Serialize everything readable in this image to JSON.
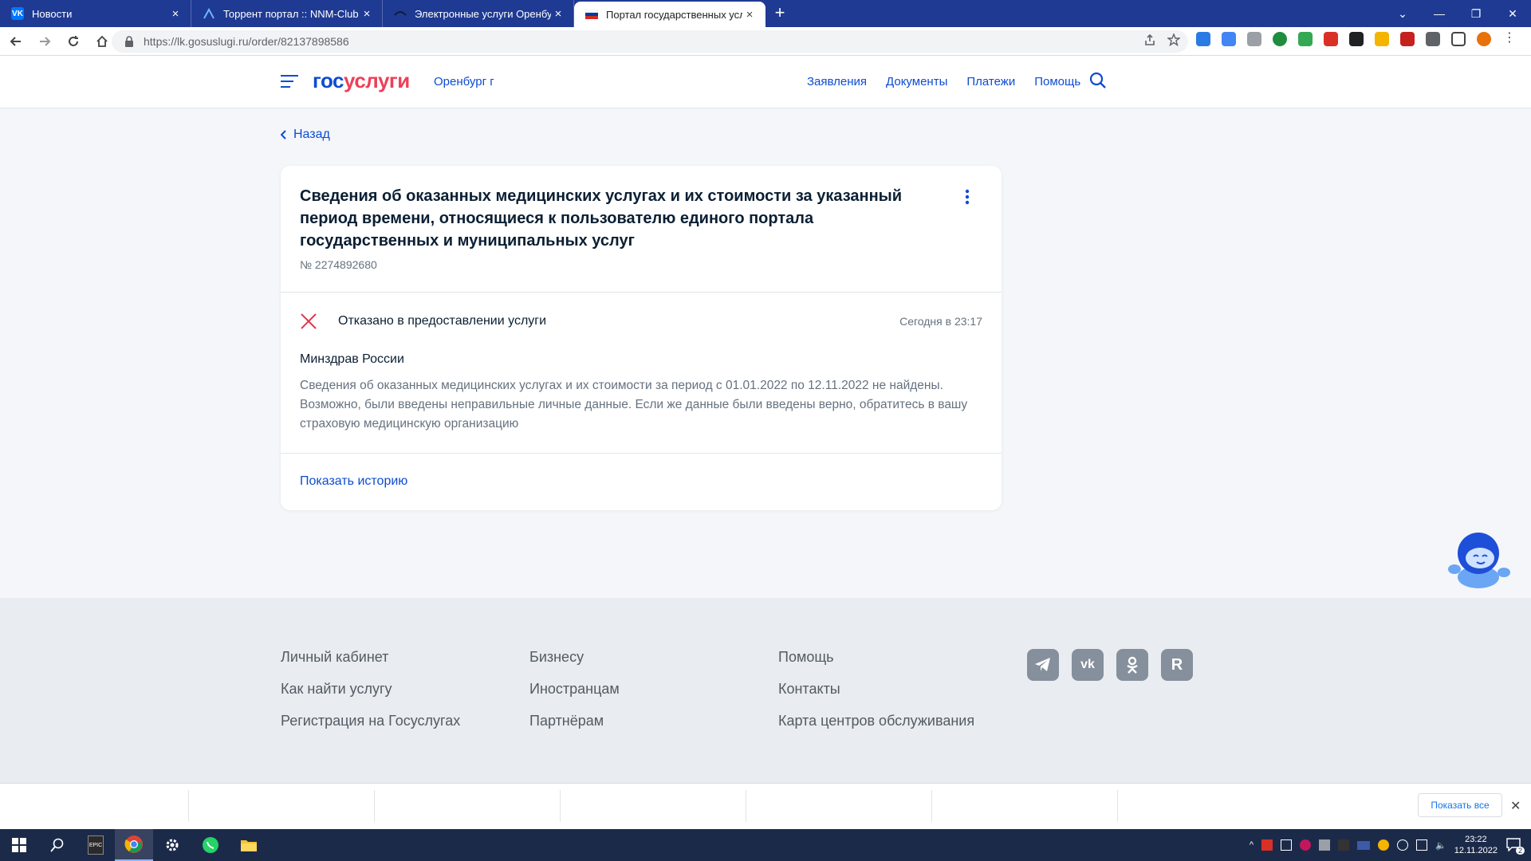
{
  "browser": {
    "tabs": [
      {
        "title": "Новости",
        "favicon": "VK",
        "favicon_color": "#0077ff"
      },
      {
        "title": "Торрент портал :: NNM-Club",
        "favicon": "",
        "favicon_color": "#3b8fd8"
      },
      {
        "title": "Электронные услуги Оренбургс",
        "favicon": "",
        "favicon_color": "#1f3a93"
      },
      {
        "title": "Портал государственных услуг",
        "favicon": "",
        "favicon_color": "#ffffff"
      }
    ],
    "url": "https://lk.gosuslugi.ru/order/82137898586"
  },
  "header": {
    "logo_part1": "гос",
    "logo_part2": "услуги",
    "region": "Оренбург г",
    "nav": [
      "Заявления",
      "Документы",
      "Платежи",
      "Помощь"
    ]
  },
  "back_label": "Назад",
  "order": {
    "title": "Сведения об оказанных медицинских услугах и их стоимости за указанный период времени, относящиеся к пользователю единого портала государственных и муниципальных услуг",
    "number": "№ 2274892680",
    "status": "Отказано в предоставлении услуги",
    "status_time": "Сегодня в 23:17",
    "organization": "Минздрав России",
    "message": "Сведения об оказанных медицинских услугах и их стоимости за период с 01.01.2022 по 12.11.2022 не найдены. Возможно, были введены неправильные личные данные. Если же данные были введены верно, обратитесь в вашу страховую медицинскую организацию",
    "history_link": "Показать историю"
  },
  "footer": {
    "col1": [
      "Личный кабинет",
      "Как найти услугу",
      "Регистрация на Госуслугах"
    ],
    "col2": [
      "Бизнесу",
      "Иностранцам",
      "Партнёрам"
    ],
    "col3": [
      "Помощь",
      "Контакты",
      "Карта центров обслуживания"
    ],
    "socials": [
      "telegram-icon",
      "vk-icon",
      "odnoklassniki-icon",
      "rutube-icon"
    ]
  },
  "downloads": {
    "show_all": "Показать все"
  },
  "taskbar": {
    "time": "23:22",
    "date": "12.11.2022",
    "notifications": "2"
  }
}
